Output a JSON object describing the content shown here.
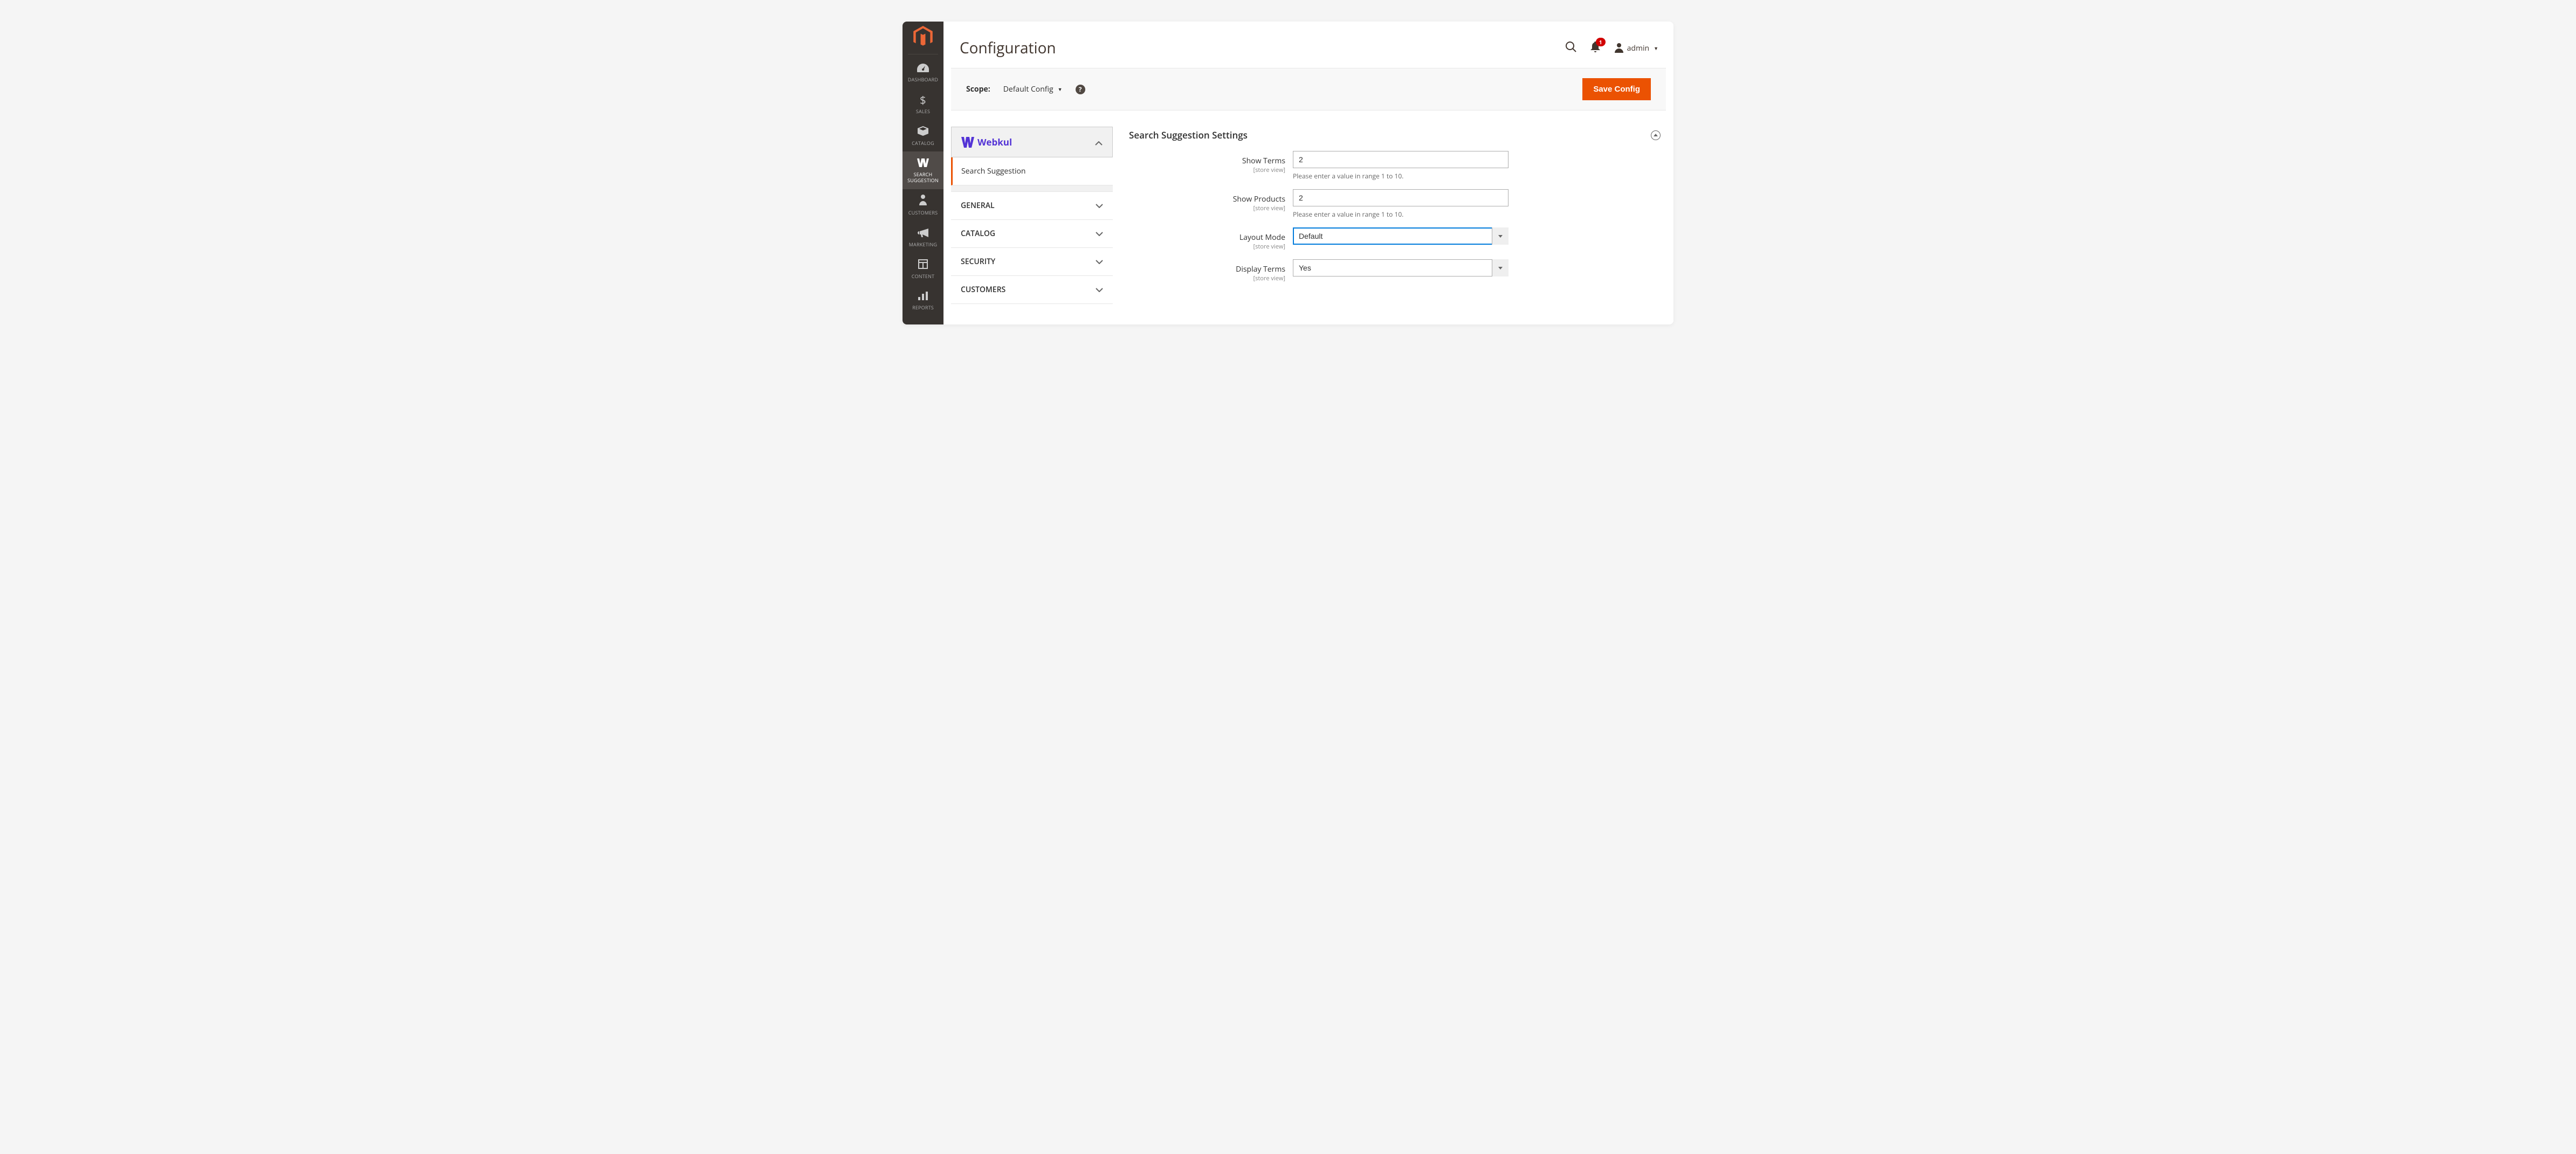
{
  "sidebar": {
    "items": [
      {
        "label": "DASHBOARD"
      },
      {
        "label": "SALES"
      },
      {
        "label": "CATALOG"
      },
      {
        "label": "SEARCH SUGGESTION"
      },
      {
        "label": "CUSTOMERS"
      },
      {
        "label": "MARKETING"
      },
      {
        "label": "CONTENT"
      },
      {
        "label": "REPORTS"
      }
    ]
  },
  "header": {
    "title": "Configuration",
    "notification_count": "1",
    "account_label": "admin"
  },
  "scope_bar": {
    "label": "Scope:",
    "value": "Default Config",
    "save_button": "Save Config"
  },
  "config_nav": {
    "brand": "Webkul",
    "active_sub": "Search Suggestion",
    "tabs": [
      {
        "label": "GENERAL"
      },
      {
        "label": "CATALOG"
      },
      {
        "label": "SECURITY"
      },
      {
        "label": "CUSTOMERS"
      }
    ]
  },
  "section": {
    "title": "Search Suggestion Settings",
    "scope_hint": "[store view]",
    "fields": {
      "show_terms": {
        "label": "Show Terms",
        "value": "2",
        "note": "Please enter a value in range 1 to 10."
      },
      "show_products": {
        "label": "Show Products",
        "value": "2",
        "note": "Please enter a value in range 1 to 10."
      },
      "layout_mode": {
        "label": "Layout Mode",
        "value": "Default"
      },
      "display_terms": {
        "label": "Display Terms",
        "value": "Yes"
      }
    }
  }
}
